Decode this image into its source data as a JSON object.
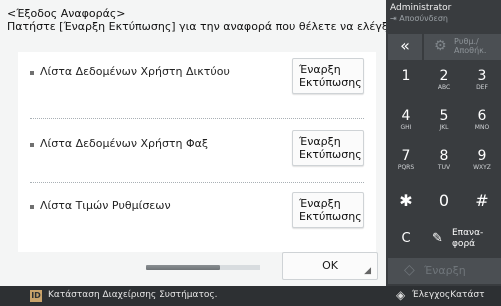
{
  "header": {
    "title": "<Έξοδος Αναφοράς>",
    "instruction": "Πατήστε [Έναρξη Εκτύπωσης] για την αναφορά που θέλετε να ελέγξετε."
  },
  "reports": [
    {
      "label": "Λίστα Δεδομένων Χρήστη Δικτύου",
      "button_line1": "Έναρξη",
      "button_line2": "Εκτύπωσης"
    },
    {
      "label": "Λίστα Δεδομένων Χρήστη Φαξ",
      "button_line1": "Έναρξη",
      "button_line2": "Εκτύπωσης"
    },
    {
      "label": "Λίστα Τιμών Ρυθμίσεων",
      "button_line1": "Έναρξη",
      "button_line2": "Εκτύπωσης"
    }
  ],
  "footer": {
    "ok_label": "OK",
    "scroll_progress": 0.65
  },
  "status_bar": {
    "id_badge": "ID",
    "status_text": "Κατάσταση Διαχείρισης Συστήματος.",
    "monitor_text": "ΈλεγχοςΚατάστ"
  },
  "panel": {
    "user": "Administrator",
    "logout": "⇥ Αποσύνδεση",
    "back_icon": "«",
    "settings_line1": "Ρυθμ./",
    "settings_line2": "Αποθήκ.",
    "keys": [
      {
        "num": "1",
        "sub": ""
      },
      {
        "num": "2",
        "sub": "ABC"
      },
      {
        "num": "3",
        "sub": "DEF"
      },
      {
        "num": "4",
        "sub": "GHI"
      },
      {
        "num": "5",
        "sub": "JKL"
      },
      {
        "num": "6",
        "sub": "MNO"
      },
      {
        "num": "7",
        "sub": "PQRS"
      },
      {
        "num": "8",
        "sub": "TUV"
      },
      {
        "num": "9",
        "sub": "WXYZ"
      }
    ],
    "star": "✱",
    "zero": "0",
    "hash": "#",
    "c_key": "C",
    "clear_line1": "Επανα-",
    "clear_line2": "φορά",
    "start_label": "Έναρξη"
  },
  "colors": {
    "panel_bg": "#393c3f",
    "status_bg": "#2d3033",
    "main_bg": "#f4f5f5"
  }
}
